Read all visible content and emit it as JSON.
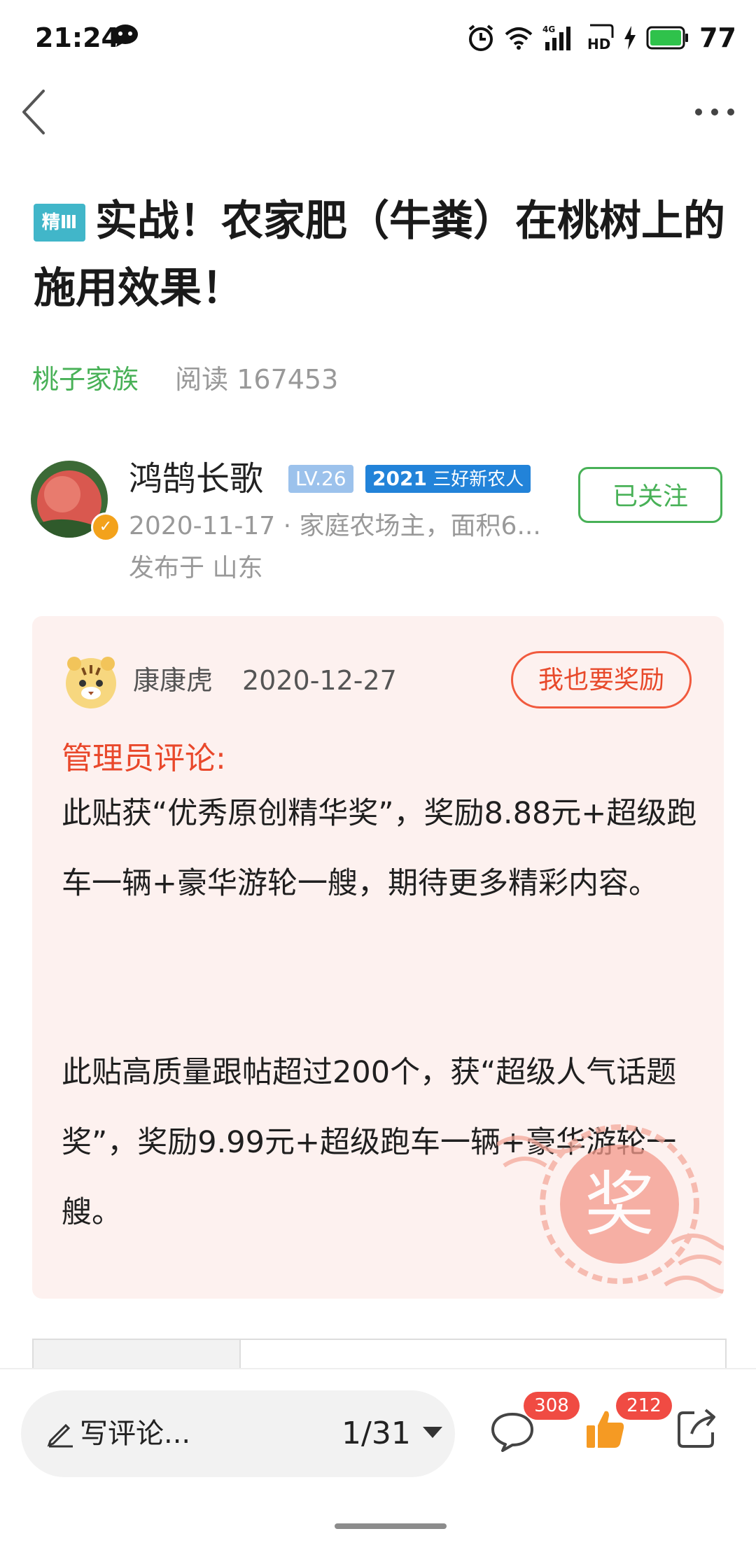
{
  "status_bar": {
    "time": "21:24",
    "battery": "77",
    "network_label": "4G"
  },
  "post": {
    "badge": "精Ⅲ",
    "title": "实战！农家肥（牛粪）在桃树上的施用效果！",
    "tag": "桃子家族",
    "read_label": "阅读",
    "read_count": "167453"
  },
  "author": {
    "name": "鸿鹄长歌",
    "level": "LV.26",
    "honor_year": "2021",
    "honor_text": "三好新农人",
    "meta": "2020-11-17 · 家庭农场主，面积6...",
    "location": "发布于 山东",
    "follow_label": "已关注"
  },
  "admin_comment": {
    "admin_name": "康康虎",
    "date": "2020-12-27",
    "reward_button": "我也要奖励",
    "label": "管理员评论:",
    "paragraph_1": "此贴获“优秀原创精华奖”，奖励8.88元+超级跑车一辆+豪华游轮一艘，期待更多精彩内容。",
    "paragraph_2": "此贴高质量跟帖超过200个，获“超级人气话题奖”，奖励9.99元+超级跑车一辆+豪华游轮一艘。",
    "stamp_text": "奖"
  },
  "bottom_bar": {
    "comment_placeholder": "写评论...",
    "page_indicator": "1/31",
    "comment_count": "308",
    "like_count": "212"
  },
  "colors": {
    "green": "#48b157",
    "red": "#e9482b",
    "card_bg": "#fdf1ef",
    "teal": "#41b6c9",
    "blue": "#2283d9"
  }
}
